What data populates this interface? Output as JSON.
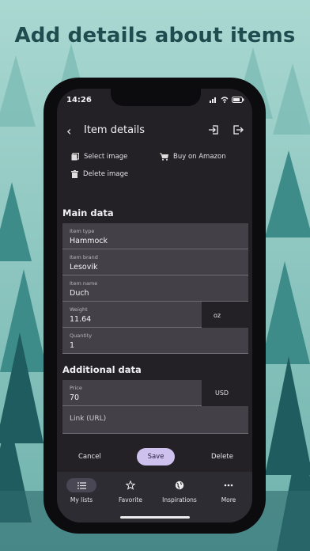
{
  "headline": "Add details about items",
  "status": {
    "time": "14:26"
  },
  "topbar": {
    "title": "Item details"
  },
  "actions": {
    "select_image": "Select image",
    "buy_on_amazon": "Buy on Amazon",
    "delete_image": "Delete image"
  },
  "sections": {
    "main": "Main data",
    "additional": "Additional data"
  },
  "fields": {
    "item_type": {
      "label": "Item type",
      "value": "Hammock"
    },
    "item_brand": {
      "label": "Item brand",
      "value": "Lesovik"
    },
    "item_name": {
      "label": "Item name",
      "value": "Duch"
    },
    "weight": {
      "label": "Weight",
      "value": "11.64",
      "unit": "oz"
    },
    "quantity": {
      "label": "Quantity",
      "value": "1"
    },
    "price": {
      "label": "Price",
      "value": "70",
      "unit": "USD"
    },
    "link": {
      "placeholder": "Link (URL)"
    }
  },
  "buttons": {
    "cancel": "Cancel",
    "save": "Save",
    "delete": "Delete"
  },
  "nav": {
    "items": [
      {
        "label": "My lists",
        "icon": "list-icon",
        "active": true
      },
      {
        "label": "Favorite",
        "icon": "star-icon",
        "active": false
      },
      {
        "label": "Inspirations",
        "icon": "globe-icon",
        "active": false
      },
      {
        "label": "More",
        "icon": "more-icon",
        "active": false
      }
    ]
  },
  "colors": {
    "background": "#8fc7c0",
    "headline": "#1f4d4f",
    "screen": "#232126",
    "field": "#434048",
    "save_button": "#cfc1ee",
    "nav_active": "#4a4755"
  }
}
